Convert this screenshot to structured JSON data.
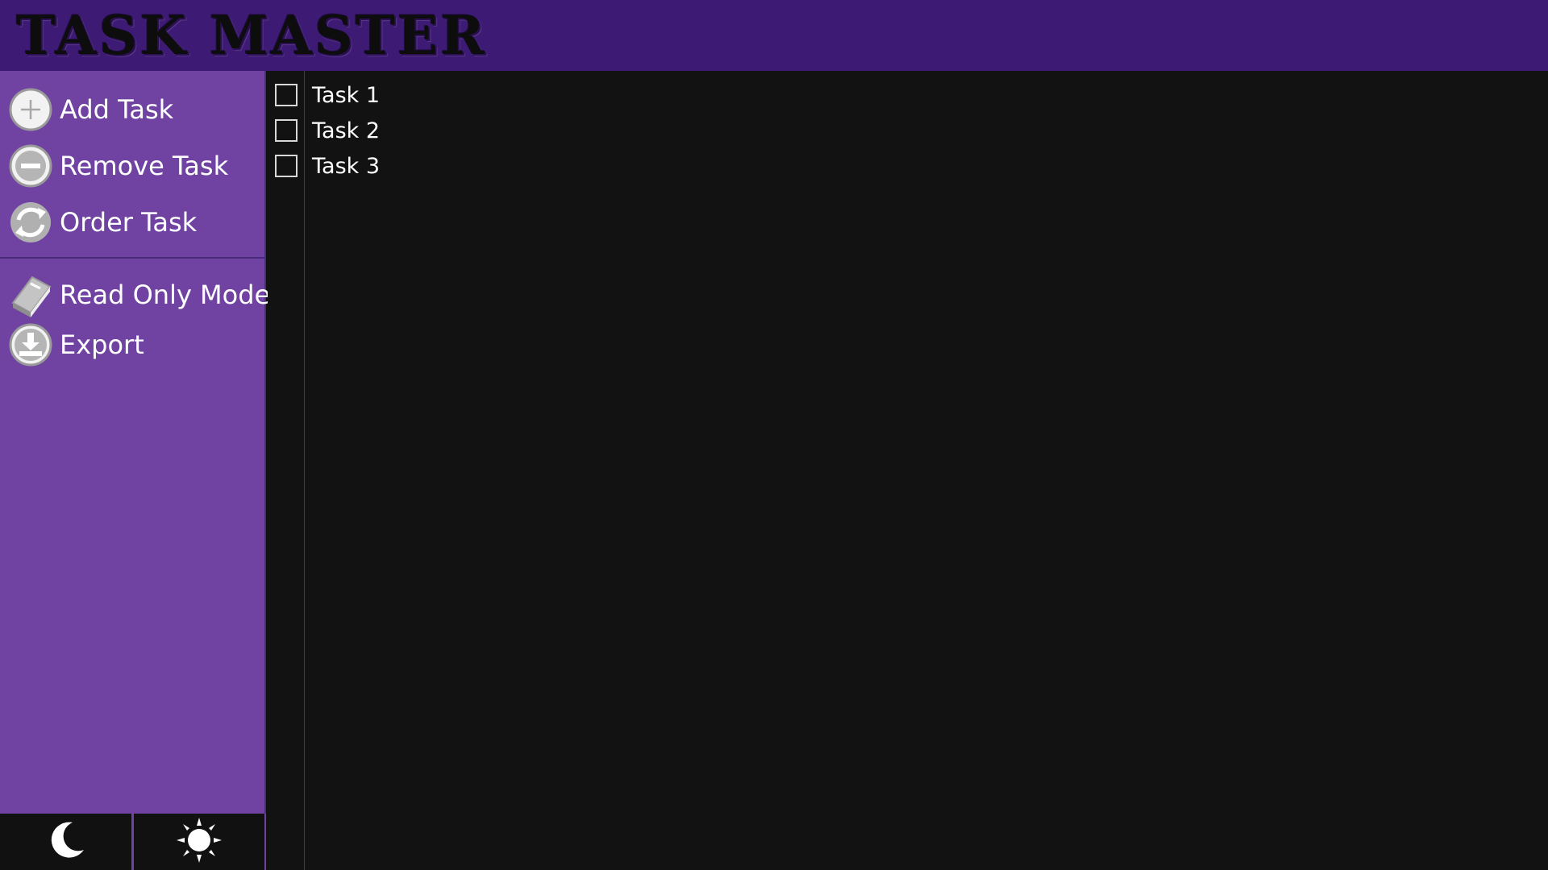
{
  "app": {
    "title": "TASK MASTER"
  },
  "sidebar": {
    "items": [
      {
        "label": "Add Task",
        "icon": "plus-circle-icon"
      },
      {
        "label": "Remove Task",
        "icon": "minus-circle-icon"
      },
      {
        "label": "Order Task",
        "icon": "refresh-icon"
      },
      {
        "label": "Read Only Mode",
        "icon": "book-icon"
      },
      {
        "label": "Export",
        "icon": "download-icon"
      }
    ]
  },
  "theme_toggle": {
    "dark_icon": "moon-icon",
    "light_icon": "sun-icon"
  },
  "tasks": [
    {
      "label": "Task 1",
      "checked": false
    },
    {
      "label": "Task 2",
      "checked": false
    },
    {
      "label": "Task 3",
      "checked": false
    }
  ],
  "colors": {
    "header": "#3d1a73",
    "sidebar": "#7043a3",
    "main_background": "#121212",
    "text": "#ffffff",
    "icon": "#c8c8c8"
  }
}
